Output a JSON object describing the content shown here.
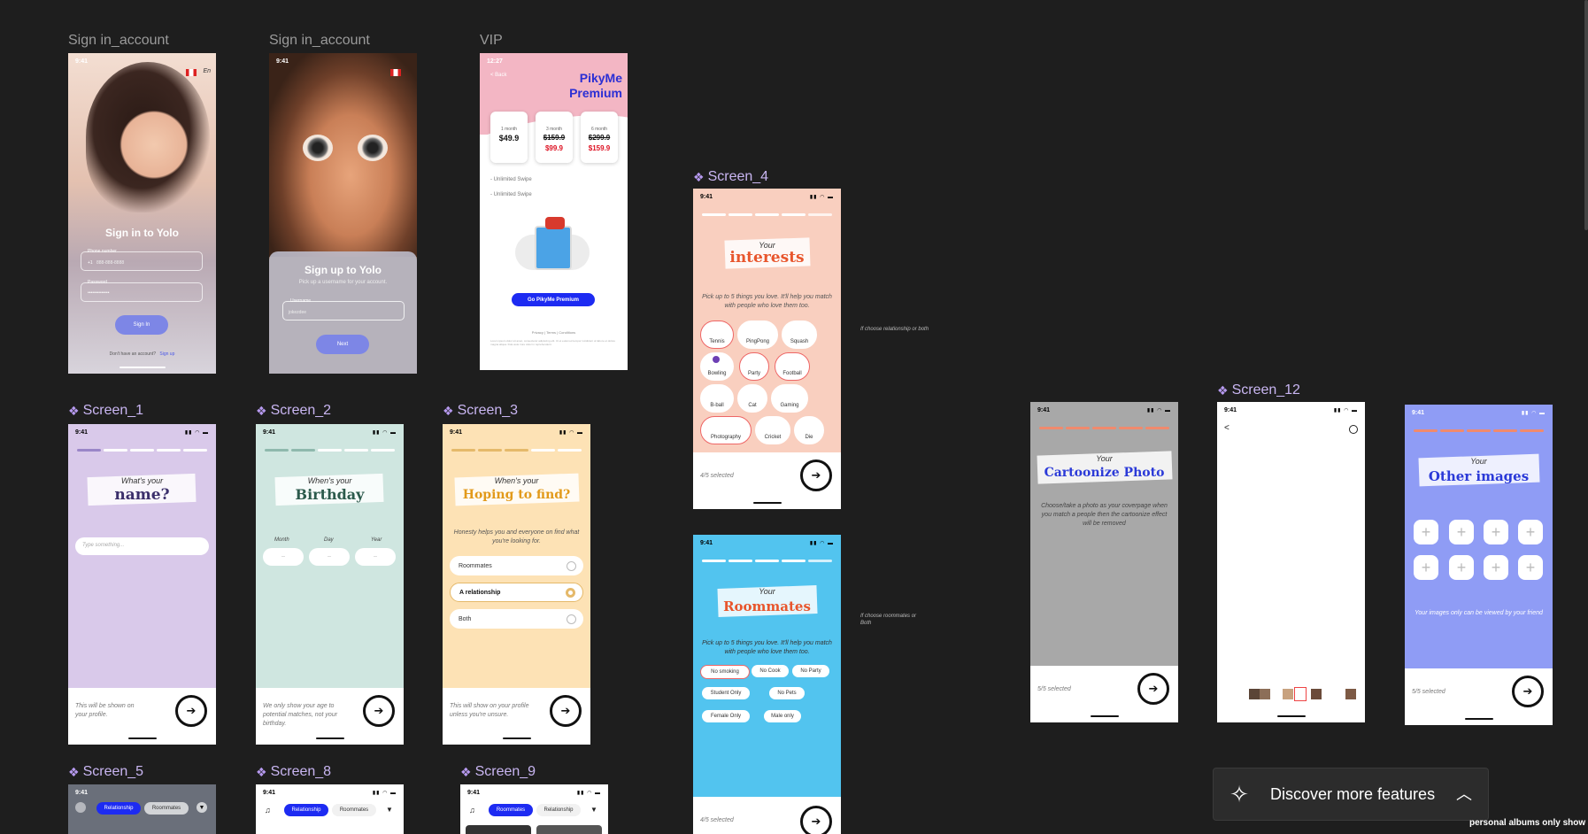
{
  "frames": {
    "signin1": {
      "label": "Sign in_account",
      "title": "Sign in to Yolo",
      "phone_label": "Phone number",
      "phone_prefix": "+1",
      "phone_placeholder": "888-888-8888",
      "password_label": "Password",
      "password_value": "••••••••••••••",
      "button": "Sign In",
      "footer_q": "Don't have an account?",
      "footer_link": "Sign up",
      "status_time": "9:41",
      "lang": "En"
    },
    "signin2": {
      "label": "Sign in_account",
      "title": "Sign up to Yolo",
      "subtitle": "Pick up a username for your account.",
      "username_label": "Username",
      "username_value": "jokezdee",
      "button": "Next",
      "status_time": "9:41"
    },
    "vip": {
      "label": "VIP",
      "status_time": "12:27",
      "back": "< Back",
      "brand_line1": "PikyMe",
      "brand_line2": "Premium",
      "plans": [
        {
          "period": "1 month",
          "price": "$49.9",
          "old": "",
          "new": ""
        },
        {
          "period": "3 month",
          "price": "",
          "old": "$159.9",
          "new": "$99.9"
        },
        {
          "period": "6 month",
          "price": "",
          "old": "$299.9",
          "new": "$159.9"
        }
      ],
      "features": [
        "- Unlimited Swipe",
        "- Unlimited Swipe"
      ],
      "cta": "Go PikyMe Premium",
      "links": [
        "Privacy",
        "Terms",
        "Conditions"
      ],
      "legal": "Lorem ipsum dolor sit amet, consectetur adipiscing elit. Ut et euismod tempor incididunt ut labore et dolore magna aliqua. Duis aute irure dolor in reprehenderit."
    },
    "screen4": {
      "label": "Screen_4",
      "status_time": "9:41",
      "small": "Your",
      "big": "interests",
      "desc": "Pick up to 5 things you love. It'll help you match with people who love them too.",
      "chips": [
        "Tennis",
        "PingPong",
        "Squash",
        "Bowling",
        "Party",
        "Football",
        "B-ball",
        "Cat",
        "Gaming",
        "Photography",
        "Cricket",
        "Die"
      ],
      "footer": "4/5 selected",
      "side_note": "If choose relationship or both"
    },
    "roommates": {
      "status_time": "9:41",
      "small": "Your",
      "big": "Roommates",
      "desc": "Pick up to 5 things you love. It'll help you match with people who love them too.",
      "pills": [
        "No smoking",
        "No Cook",
        "No Party",
        "Student Only",
        "No Pets",
        "Female Only",
        "Male only"
      ],
      "footer": "4/5 selected",
      "side_note": "If choose roommates or Both"
    },
    "screen1": {
      "label": "Screen_1",
      "status_time": "9:41",
      "small": "What's your",
      "big": "name?",
      "placeholder": "Type something...",
      "footer": "This will be shown on your profile."
    },
    "screen2": {
      "label": "Screen_2",
      "status_time": "9:41",
      "small": "When's your",
      "big": "Birthday",
      "fields": [
        "Month",
        "Day",
        "Year"
      ],
      "field_placeholder": "--",
      "footer": "We only show your age to potential matches, not your birthday."
    },
    "screen3": {
      "label": "Screen_3",
      "status_time": "9:41",
      "small": "When's your",
      "big": "Hoping to find?",
      "desc": "Honesty helps you and everyone on find what you're looking for.",
      "options": [
        "Roommates",
        "A relationship",
        "Both"
      ],
      "footer": "This will show on your profile unless you're unsure."
    },
    "cartoon": {
      "status_time": "9:41",
      "small": "Your",
      "big": "Cartoonize Photo",
      "desc": "Choose/take a photo as your coverpage when you match a people then the cartoonize effect will be removed",
      "footer": "5/5 selected"
    },
    "screen12": {
      "label": "Screen_12",
      "status_time": "9:41",
      "back": "<"
    },
    "otherimages": {
      "status_time": "9:41",
      "small": "Your",
      "big": "Other images",
      "desc": "Your images only can be viewed by your friend",
      "footer": "5/5 selected"
    },
    "screen5": {
      "label": "Screen_5",
      "status_time": "9:41",
      "tabs": [
        "Relationship",
        "Roommates"
      ]
    },
    "screen8": {
      "label": "Screen_8",
      "status_time": "9:41",
      "tabs": [
        "Relationship",
        "Roommates"
      ]
    },
    "screen9": {
      "label": "Screen_9",
      "status_time": "9:41",
      "tabs": [
        "Roommates",
        "Relationship"
      ]
    }
  },
  "toast": {
    "label": "Discover more features"
  },
  "corner_note": "personal albums only show to f",
  "colors": {
    "canvas": "#1e1e1e",
    "purple": "#d9c9ea",
    "mint": "#cfe6e0",
    "peach": "#fde2b5",
    "salmon": "#f9cfbf",
    "sky": "#52c4ef",
    "grey": "#a8a8a8",
    "periwinkle": "#8f9cf5",
    "accent": "#1d2bf2"
  }
}
